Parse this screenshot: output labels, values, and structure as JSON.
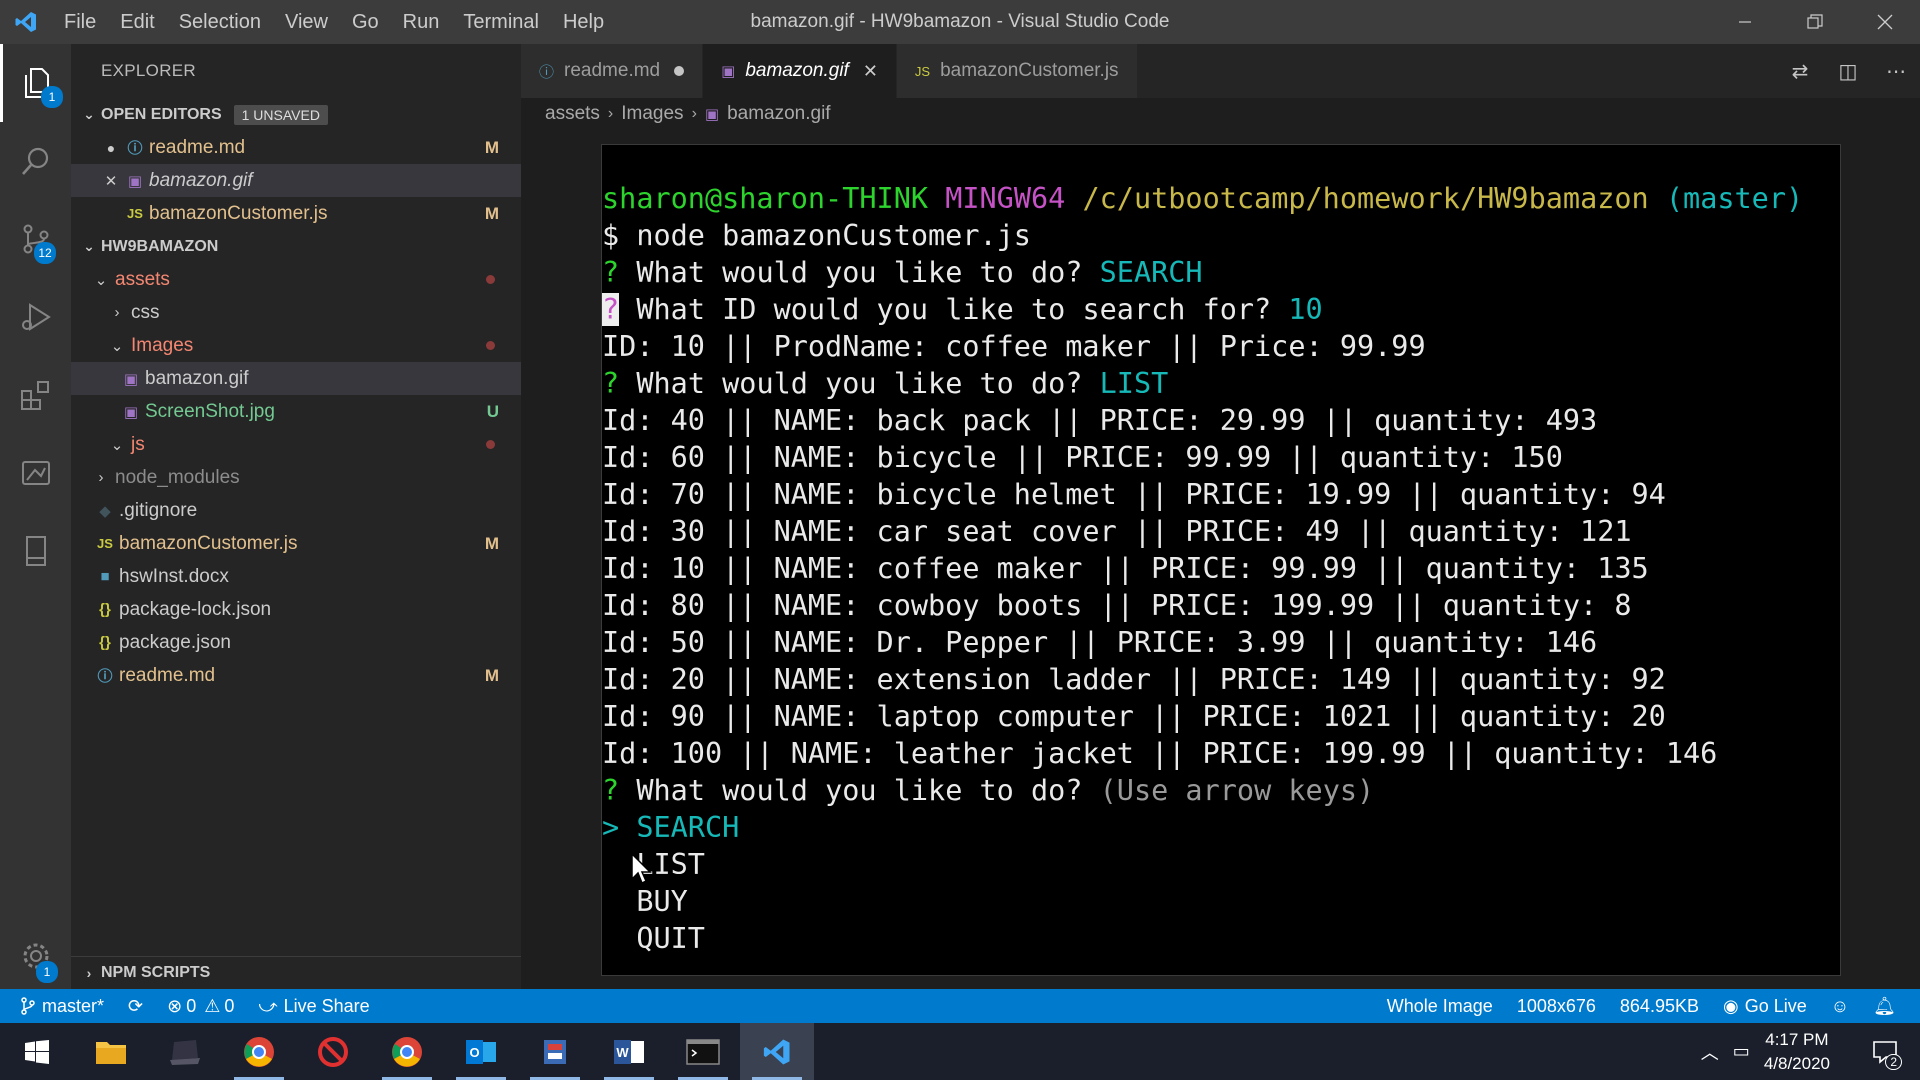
{
  "titlebar": {
    "menu": [
      "File",
      "Edit",
      "Selection",
      "View",
      "Go",
      "Run",
      "Terminal",
      "Help"
    ],
    "title": "bamazon.gif - HW9bamazon - Visual Studio Code"
  },
  "activity": {
    "explorer_badge": "1",
    "scm_badge": "12",
    "settings_badge": "1"
  },
  "sidebar": {
    "title": "EXPLORER",
    "open_editors": {
      "label": "OPEN EDITORS",
      "unsaved": "1 UNSAVED",
      "items": [
        {
          "name": "readme.md",
          "status": "M"
        },
        {
          "name": "bamazon.gif",
          "status": ""
        },
        {
          "name": "bamazonCustomer.js",
          "status": "M"
        }
      ]
    },
    "project": {
      "label": "HW9BAMAZON",
      "items": [
        {
          "name": "assets",
          "status": ""
        },
        {
          "name": "css",
          "status": ""
        },
        {
          "name": "Images",
          "status": ""
        },
        {
          "name": "bamazon.gif",
          "status": ""
        },
        {
          "name": "ScreenShot.jpg",
          "status": "U"
        },
        {
          "name": "js",
          "status": ""
        },
        {
          "name": "node_modules",
          "status": ""
        },
        {
          "name": ".gitignore",
          "status": ""
        },
        {
          "name": "bamazonCustomer.js",
          "status": "M"
        },
        {
          "name": "hswInst.docx",
          "status": ""
        },
        {
          "name": "package-lock.json",
          "status": ""
        },
        {
          "name": "package.json",
          "status": ""
        },
        {
          "name": "readme.md",
          "status": "M"
        }
      ]
    },
    "npm_scripts": "NPM SCRIPTS"
  },
  "tabs": [
    {
      "label": "readme.md"
    },
    {
      "label": "bamazon.gif"
    },
    {
      "label": "bamazonCustomer.js"
    }
  ],
  "breadcrumb": [
    "assets",
    "Images",
    "bamazon.gif"
  ],
  "terminal": {
    "prompt_user": "sharon@sharon-THINK",
    "prompt_env": "MINGW64",
    "prompt_path": "/c/utbootcamp/homework/HW9bamazon",
    "prompt_branch": "(master)",
    "command": "$ node bamazonCustomer.js",
    "q1": "What would you like to do?",
    "a1": "SEARCH",
    "q2": "What ID would you like to search for?",
    "a2": "10",
    "search_result": "ID: 10 || ProdName: coffee maker || Price: 99.99",
    "q3": "What would you like to do?",
    "a3": "LIST",
    "list": [
      "Id: 40 || NAME: back pack || PRICE: 29.99 || quantity: 493",
      "Id: 60 || NAME: bicycle || PRICE: 99.99 || quantity: 150",
      "Id: 70 || NAME: bicycle helmet || PRICE: 19.99 || quantity: 94",
      "Id: 30 || NAME: car seat cover || PRICE: 49 || quantity: 121",
      "Id: 10 || NAME: coffee maker || PRICE: 99.99 || quantity: 135",
      "Id: 80 || NAME: cowboy boots || PRICE: 199.99 || quantity: 8",
      "Id: 50 || NAME: Dr. Pepper || PRICE: 3.99 || quantity: 146",
      "Id: 20 || NAME: extension ladder || PRICE: 149 || quantity: 92",
      "Id: 90 || NAME: laptop computer || PRICE: 1021 || quantity: 20",
      "Id: 100 || NAME: leather jacket || PRICE: 199.99 || quantity: 146"
    ],
    "q4": "What would you like to do?",
    "hint": "(Use arrow keys)",
    "choices": [
      "SEARCH",
      "LIST",
      "BUY",
      "QUIT"
    ]
  },
  "statusbar": {
    "branch": "master*",
    "errors": "0",
    "warnings": "0",
    "live_share": "Live Share",
    "view_mode": "Whole Image",
    "dimensions": "1008x676",
    "file_size": "864.95KB",
    "go_live": "Go Live"
  },
  "taskbar": {
    "time": "4:17 PM",
    "date": "4/8/2020",
    "notifications": "2"
  }
}
